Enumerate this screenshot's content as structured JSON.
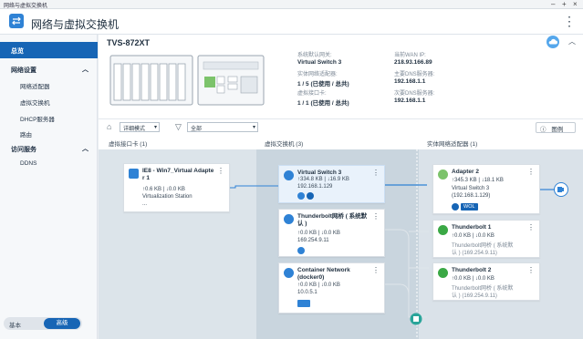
{
  "window": {
    "title": "网络与虚拟交换机"
  },
  "app": {
    "title": "网络与虚拟交换机"
  },
  "sidebar": {
    "overview": "总览",
    "network_settings": "网络设置",
    "items": [
      "网络适配器",
      "虚拟交换机",
      "DHCP服务器",
      "路由"
    ],
    "access_services": "访问服务",
    "ddns": "DDNS",
    "mode_basic": "基本",
    "mode_advanced": "高级"
  },
  "device": {
    "name": "TVS-872XT",
    "default_gateway_label": "系统默认网关:",
    "default_gateway": "Virtual Switch 3",
    "physical_adapters_label": "实体网络适配器:",
    "physical_adapters": "1 / 5 (已使用 / 总共)",
    "virtual_ports_label": "虚拟接口卡:",
    "virtual_ports": "1 / 1 (已使用 / 总共)",
    "wan_ip_label": "当前WAN IP:",
    "wan_ip": "218.93.166.89",
    "primary_dns_label": "主要DNS服务器:",
    "primary_dns": "192.168.1.1",
    "secondary_dns_label": "次要DNS服务器:",
    "secondary_dns": "192.168.1.1"
  },
  "toolbar": {
    "view_mode": "详细模式",
    "filter": "全部",
    "legend": "图例"
  },
  "columns": {
    "vnic": "虚拟接口卡 (1)",
    "vswitch": "虚拟交换机 (3)",
    "physical": "实体网络适配器 (1)"
  },
  "vnic_cards": [
    {
      "title_line1": "IE8 - Win7_Virtual Adapte",
      "title_line2": "r 1",
      "traffic": "↑0.6 KB | ↓0.0 KB",
      "station": "Virtualization Station",
      "extra": "..."
    }
  ],
  "vswitch_cards": [
    {
      "title_line1": "Virtual Switch 3",
      "title_line2": "",
      "traffic": "↑334.8 KB | ↓16.9 KB",
      "ip": "192.168.1.129"
    },
    {
      "title_line1": "Thunderbolt网桥 ( 系统默",
      "title_line2": "认 )",
      "traffic": "↑0.0 KB | ↓0.0 KB",
      "ip": "169.254.9.11"
    },
    {
      "title_line1": "Container Network",
      "title_line2": "(docker0)",
      "traffic": "↑0.0 KB | ↓0.0 KB",
      "ip": "10.0.5.1"
    }
  ],
  "physical_cards": [
    {
      "title": "Adapter 2",
      "traffic": "↑345.3 KB | ↓18.1 KB",
      "l1": "Virtual Switch 3",
      "l2": "(192.168.1.129)",
      "badge": "WOL"
    },
    {
      "title": "Thunderbolt 1",
      "traffic": "↑0.0 KB | ↓0.0 KB",
      "l1": "Thunderbolt网桥 ( 系统默",
      "l2": "认 ) (169.254.9.11)"
    },
    {
      "title": "Thunderbolt 2",
      "traffic": "↑0.0 KB | ↓0.0 KB",
      "l1": "Thunderbolt网桥 ( 系统默",
      "l2": "认 ) (169.254.9.11)"
    }
  ],
  "colors": {
    "accent": "#1765b5",
    "link": "#2f82d5",
    "adapter_green": "#7cc36b",
    "thunderbolt_green": "#3aa845"
  }
}
